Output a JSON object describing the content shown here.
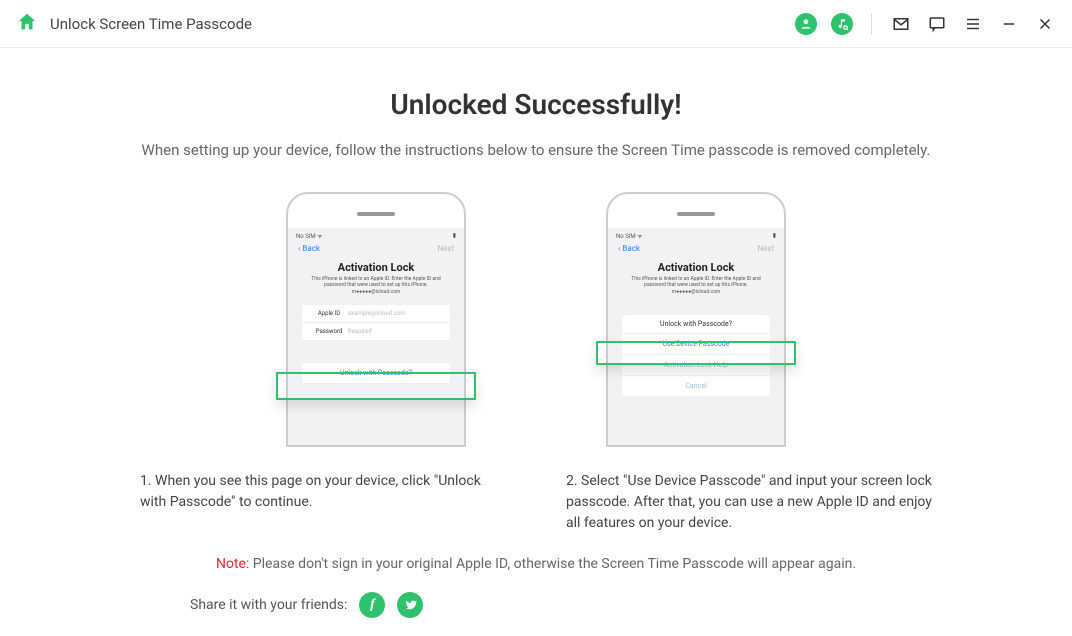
{
  "header": {
    "title": "Unlock Screen Time Passcode"
  },
  "main": {
    "title": "Unlocked Successfully!",
    "subtitle": "When setting up your device, follow the instructions below to ensure the Screen Time passcode is removed completely."
  },
  "phone": {
    "status_left": "No SIM ᯤ",
    "status_right": "▮",
    "back": "Back",
    "next": "Next",
    "al_title": "Activation Lock",
    "al_text": "This iPhone is linked to an Apple ID. Enter the Apple ID and password that were used to set up this iPhone. m●●●●●@icloud.com",
    "appleid_label": "Apple ID",
    "appleid_ph": "example@icloud.com",
    "pw_label": "Password",
    "pw_ph": "Required",
    "unlock_passcode": "Unlock with Passcode?",
    "use_device_passcode": "Use Device Passcode",
    "al_help": "Activation Lock Help",
    "cancel": "Cancel"
  },
  "steps": {
    "s1": "1. When you see this page on your device, click \"Unlock with Passcode\" to continue.",
    "s2": "2. Select \"Use Device Passcode\" and input your screen lock passcode. After that, you can use a new Apple ID and enjoy all features on your device."
  },
  "note": {
    "label": "Note:",
    "text": " Please don't sign in your original Apple ID, otherwise the Screen Time Passcode will appear again."
  },
  "share": {
    "label": "Share it with your friends:",
    "fb": "f",
    "tw": "t"
  }
}
